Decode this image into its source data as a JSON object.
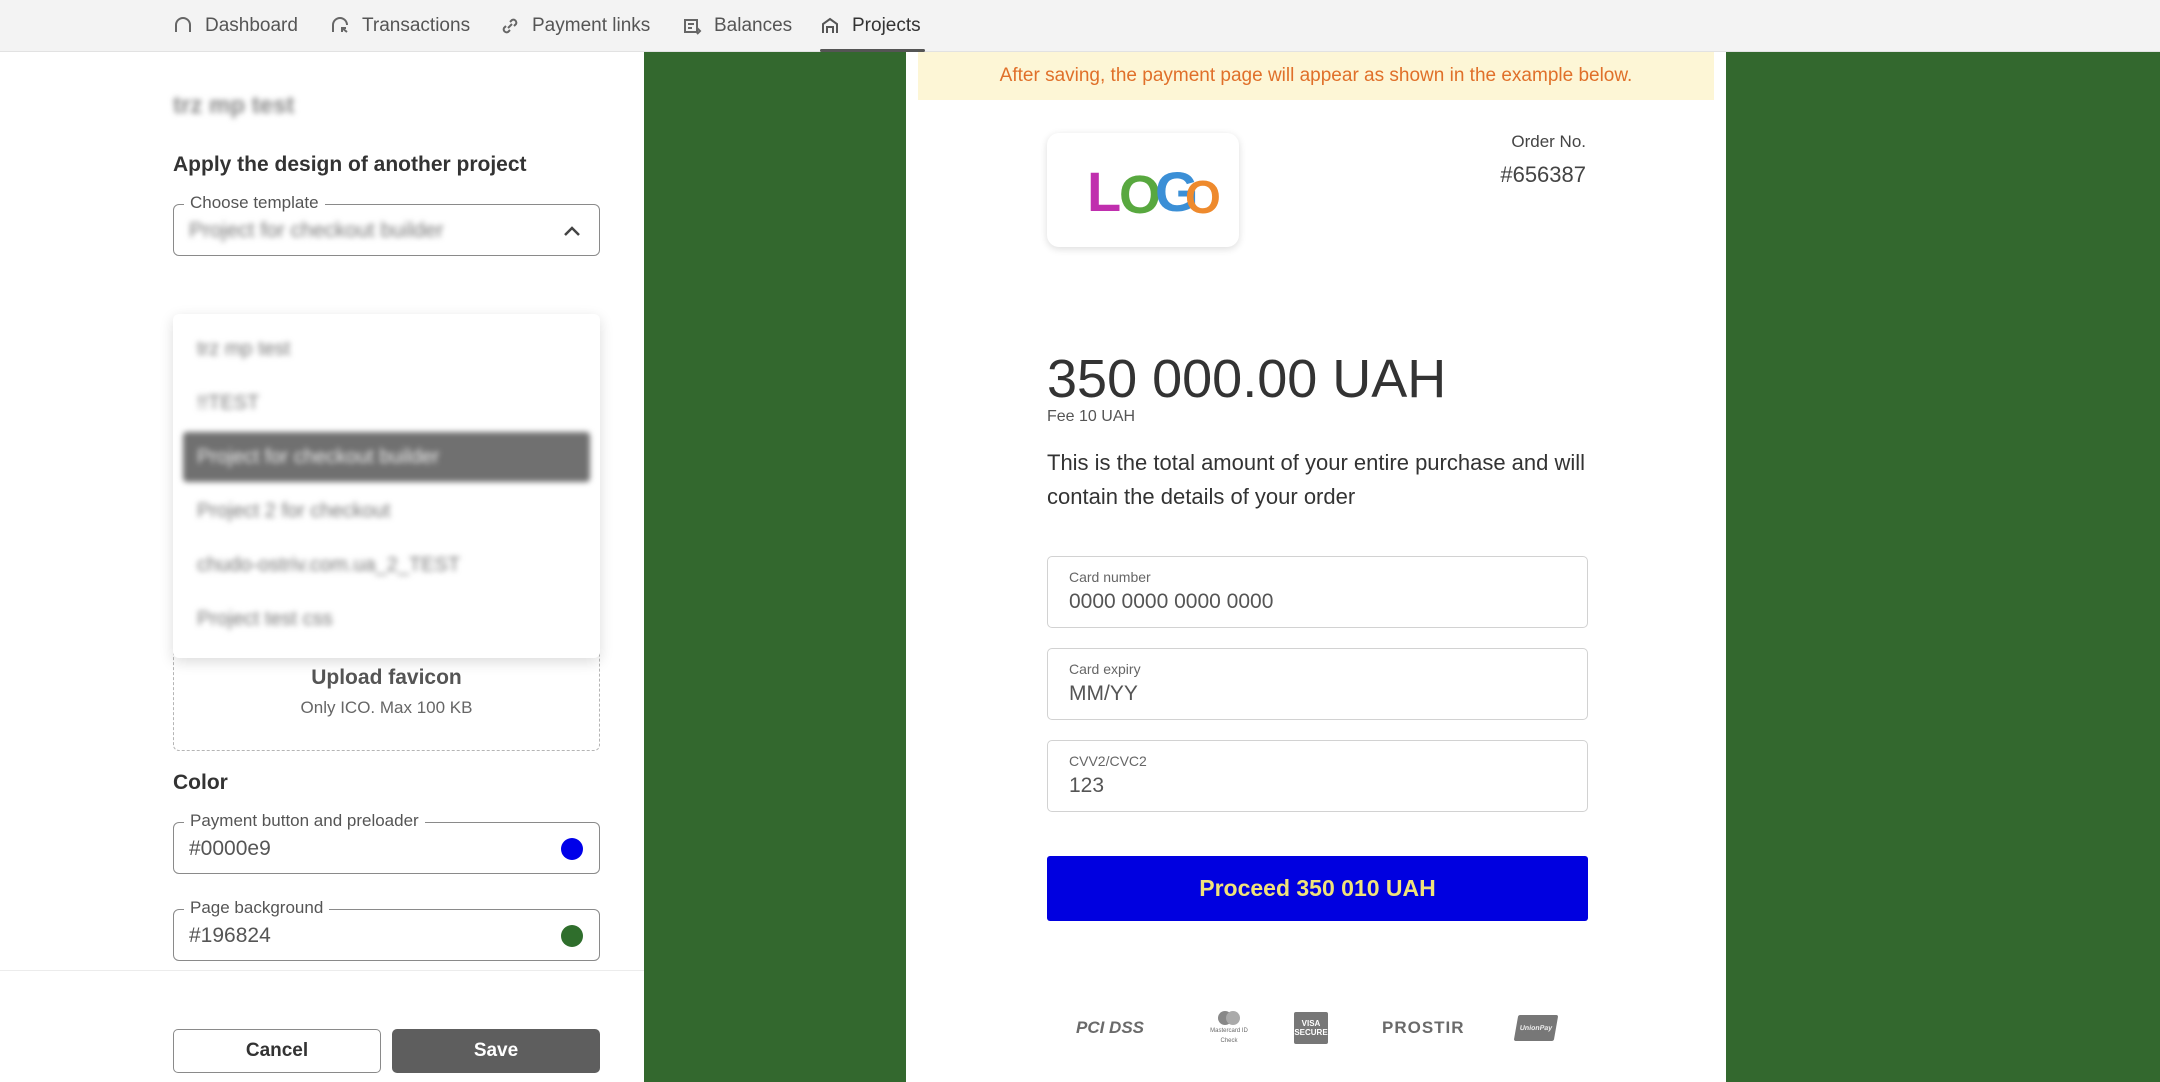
{
  "nav": {
    "items": [
      {
        "label": "Dashboard",
        "icon": "home-icon"
      },
      {
        "label": "Transactions",
        "icon": "transactions-icon"
      },
      {
        "label": "Payment links",
        "icon": "link-icon"
      },
      {
        "label": "Balances",
        "icon": "balances-icon"
      },
      {
        "label": "Projects",
        "icon": "projects-icon",
        "active": true
      }
    ]
  },
  "left": {
    "project_title": "trz mp test",
    "design_heading": "Apply the design of another project",
    "template_field": {
      "legend": "Choose template",
      "value": "Project for checkout builder"
    },
    "dropdown_options": [
      "trz mp test",
      "!!TEST",
      "Project for checkout builder",
      "Project 2 for checkout",
      "chudo-ostriv.com.ua_2_TEST",
      "Project test css"
    ],
    "selected_option": "Project for checkout builder",
    "favicon": {
      "title": "Upload favicon",
      "subtitle": "Only ICO. Max 100 KB"
    },
    "color_heading": "Color",
    "payment_button_color": {
      "legend": "Payment button and preloader",
      "value": "#0000e9"
    },
    "page_background_color": {
      "legend": "Page background",
      "value": "#196824"
    },
    "cancel_label": "Cancel",
    "save_label": "Save"
  },
  "preview": {
    "banner": "After saving, the payment page will appear as shown in the example below.",
    "logo_text": "LOGO",
    "order_label": "Order No.",
    "order_number": "#656387",
    "amount": "350 000.00 UAH",
    "fee": "Fee 10 UAH",
    "description": "This is the total amount of your entire purchase and will contain the details of your order",
    "card_number": {
      "label": "Card number",
      "placeholder": "0000 0000 0000 0000"
    },
    "card_expiry": {
      "label": "Card expiry",
      "placeholder": "MM/YY"
    },
    "cvv": {
      "label": "CVV2/CVC2",
      "placeholder": "123"
    },
    "pay_button": "Proceed 350 010 UAH",
    "badges": [
      "PCI DSS",
      "Mastercard ID Check",
      "VISA SECURE",
      "PROSTIR",
      "UnionPay"
    ]
  },
  "colors": {
    "page_background": "#33682e",
    "pay_button_bg": "#0000e0",
    "pay_button_text": "#f0e37a",
    "banner_bg": "#fdf6d6",
    "banner_text": "#e0702a",
    "swatch_blue": "#0000e9",
    "swatch_green": "#2f6e2c"
  }
}
